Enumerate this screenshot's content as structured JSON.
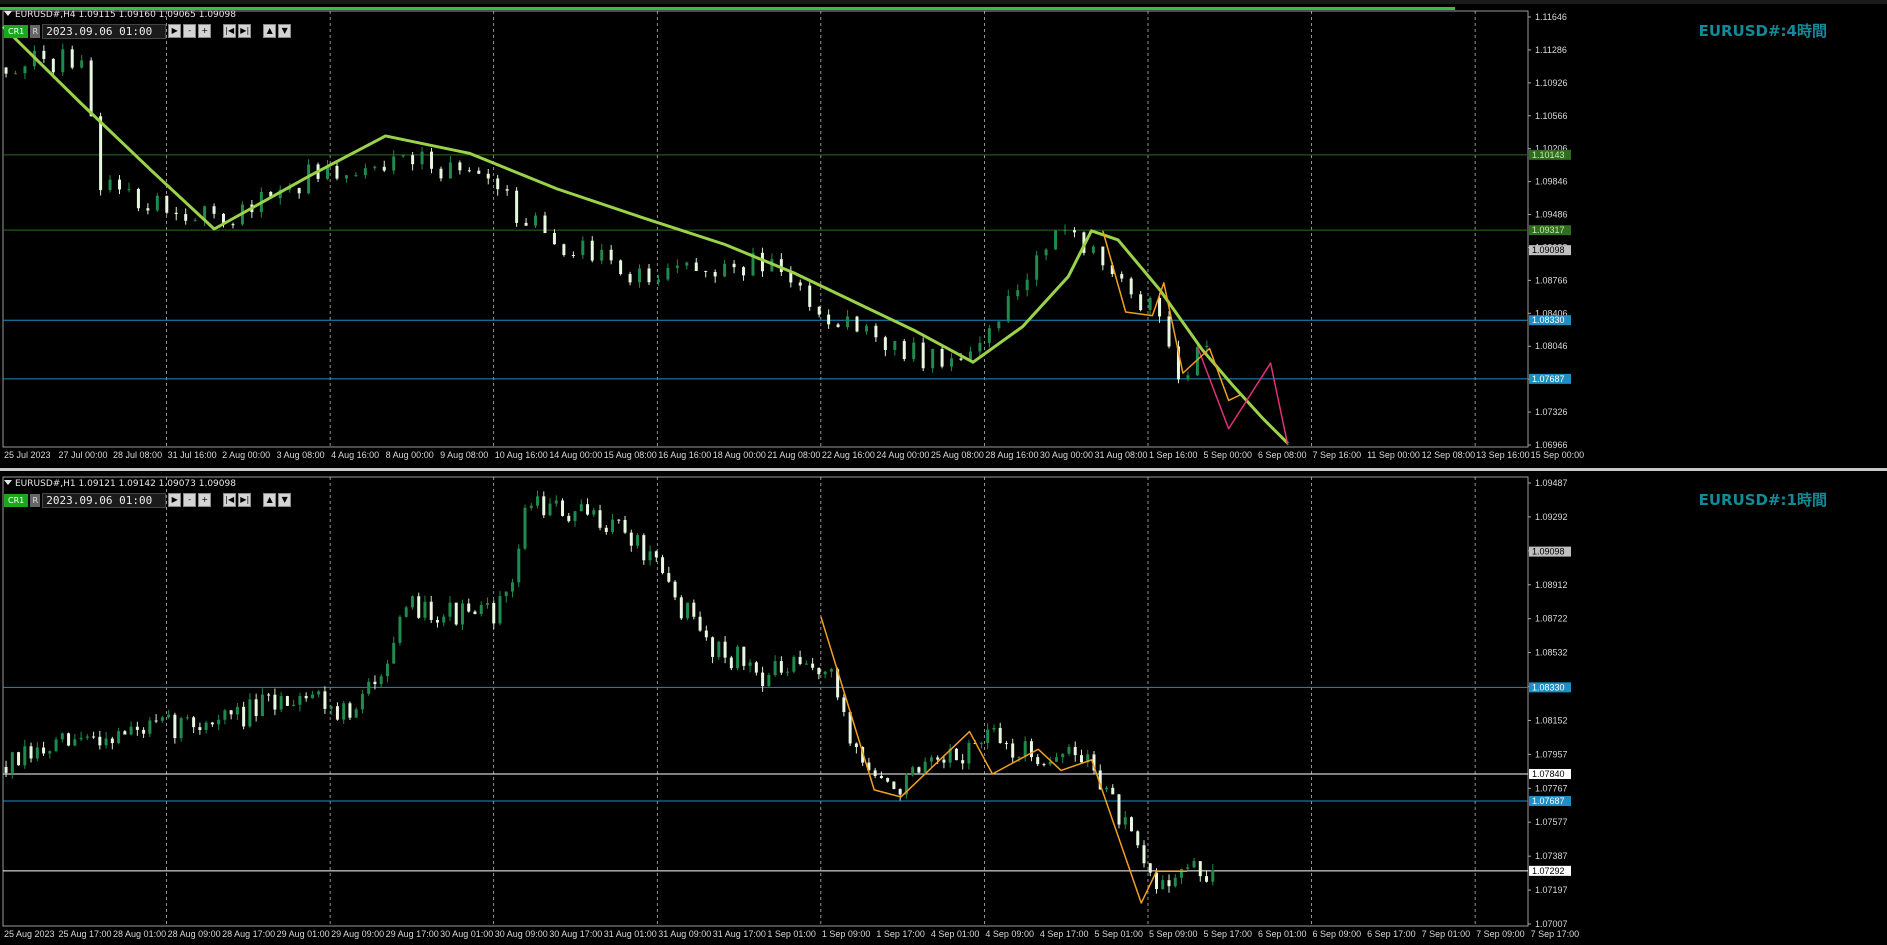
{
  "chart_data": [
    {
      "type": "candlestick",
      "header": "EURUSD#,H4  1.09115 1.09160 1.09065 1.09098",
      "title": "EURUSD#:4時間",
      "toolbar": {
        "cr": "CR1",
        "r": "R",
        "date": "2023.09.06 01:00",
        "buttons": [
          "▶",
          "-",
          "+",
          "|◀",
          "▶|",
          "▲",
          "▼"
        ]
      },
      "ylim": [
        1.0694,
        1.1172
      ],
      "price_ticks": [
        "1.11646",
        "1.11286",
        "1.10926",
        "1.10566",
        "1.10206",
        "1.09846",
        "1.09486",
        "1.09098",
        "1.08766",
        "1.08406",
        "1.08046",
        "1.07687",
        "1.07326",
        "1.06966"
      ],
      "price_labels": [
        {
          "value": 1.10143,
          "text": "1.10143",
          "bg": "#2f6e1e",
          "fg": "#c8e6b0"
        },
        {
          "value": 1.09317,
          "text": "1.09317",
          "bg": "#2f6e1e",
          "fg": "#c8e6b0"
        },
        {
          "value": 1.09098,
          "text": "1.09098",
          "bg": "#c0c0c0",
          "fg": "#000000"
        },
        {
          "value": 1.0833,
          "text": "1.08330",
          "bg": "#1e8fc0",
          "fg": "#ffffff"
        },
        {
          "value": 1.07687,
          "text": "1.07687",
          "bg": "#1e8fc0",
          "fg": "#ffffff"
        }
      ],
      "time_ticks": [
        "25 Jul 2023",
        "27 Jul 00:00",
        "28 Jul 08:00",
        "31 Jul 16:00",
        "2 Aug 00:00",
        "3 Aug 08:00",
        "4 Aug 16:00",
        "8 Aug 00:00",
        "9 Aug 08:00",
        "10 Aug 16:00",
        "14 Aug 00:00",
        "15 Aug 08:00",
        "16 Aug 16:00",
        "18 Aug 00:00",
        "21 Aug 08:00",
        "22 Aug 16:00",
        "24 Aug 00:00",
        "25 Aug 08:00",
        "28 Aug 16:00",
        "30 Aug 00:00",
        "31 Aug 08:00",
        "1 Sep 16:00",
        "5 Sep 00:00",
        "6 Sep 08:00",
        "7 Sep 16:00",
        "11 Sep 00:00",
        "12 Sep 08:00",
        "13 Sep 16:00",
        "15 Sep 00:00"
      ],
      "hlines": [
        {
          "value": 1.10143,
          "color": "#2d6e1d"
        },
        {
          "value": 1.09317,
          "color": "#2d6e1d"
        },
        {
          "value": 1.0833,
          "color": "#1e8fc0"
        },
        {
          "value": 1.07687,
          "color": "#1e8fc0"
        }
      ],
      "ma_line": {
        "color": "#9ad24a",
        "points": [
          [
            0.0,
            1.1155
          ],
          [
            0.051,
            1.1071
          ],
          [
            0.098,
            1.0996
          ],
          [
            0.1385,
            1.0933
          ],
          [
            0.2008,
            1.0991
          ],
          [
            0.2508,
            1.1035
          ],
          [
            0.3058,
            1.1016
          ],
          [
            0.3633,
            1.0977
          ],
          [
            0.4184,
            1.0946
          ],
          [
            0.4734,
            1.0916
          ],
          [
            0.5184,
            1.0885
          ],
          [
            0.5585,
            1.0853
          ],
          [
            0.5985,
            1.0821
          ],
          [
            0.6361,
            1.0787
          ],
          [
            0.6686,
            1.0826
          ],
          [
            0.6986,
            1.0881
          ],
          [
            0.7137,
            1.0931
          ],
          [
            0.7312,
            1.0921
          ],
          [
            0.7587,
            1.0866
          ],
          [
            0.7862,
            1.0801
          ],
          [
            0.8062,
            1.0762
          ],
          [
            0.8263,
            1.0725
          ],
          [
            0.8425,
            1.0698
          ]
        ]
      },
      "zigzag_orange": {
        "color": "#f0a020",
        "points": [
          [
            0.7212,
            1.0931
          ],
          [
            0.7362,
            1.0842
          ],
          [
            0.7537,
            1.0838
          ],
          [
            0.7612,
            1.0874
          ],
          [
            0.7737,
            1.0775
          ],
          [
            0.7912,
            1.0802
          ],
          [
            0.8037,
            1.0745
          ],
          [
            0.8112,
            1.0751
          ]
        ]
      },
      "zigzag_magenta": {
        "color": "#e0307a",
        "points": [
          [
            0.7837,
            1.0802
          ],
          [
            0.8037,
            1.0714
          ],
          [
            0.8312,
            1.0786
          ],
          [
            0.8425,
            1.0696
          ]
        ]
      }
    },
    {
      "type": "candlestick",
      "header": "EURUSD#,H1  1.09121 1.09142 1.09073 1.09098",
      "title": "EURUSD#:1時間",
      "toolbar": {
        "cr": "CR1",
        "r": "R",
        "date": "2023.09.06 01:00",
        "buttons": [
          "▶",
          "-",
          "+",
          "|◀",
          "▶|",
          "▲",
          "▼"
        ]
      },
      "ylim": [
        1.0698,
        1.0952
      ],
      "price_ticks": [
        "1.09487",
        "1.09292",
        "1.09098",
        "1.08912",
        "1.08722",
        "1.08532",
        "1.08342",
        "1.08152",
        "1.07957",
        "1.07767",
        "1.07577",
        "1.07387",
        "1.07197",
        "1.07007"
      ],
      "price_labels": [
        {
          "value": 1.09098,
          "text": "1.09098",
          "bg": "#c0c0c0",
          "fg": "#000000"
        },
        {
          "value": 1.0833,
          "text": "1.08330",
          "bg": "#1e8fc0",
          "fg": "#ffffff"
        },
        {
          "value": 1.0784,
          "text": "1.07840",
          "bg": "#ffffff",
          "fg": "#000000"
        },
        {
          "value": 1.07687,
          "text": "1.07687",
          "bg": "#1e8fc0",
          "fg": "#ffffff"
        },
        {
          "value": 1.07292,
          "text": "1.07292",
          "bg": "#ffffff",
          "fg": "#000000"
        }
      ],
      "time_ticks": [
        "25 Aug 2023",
        "25 Aug 17:00",
        "28 Aug 01:00",
        "28 Aug 09:00",
        "28 Aug 17:00",
        "29 Aug 01:00",
        "29 Aug 09:00",
        "29 Aug 17:00",
        "30 Aug 01:00",
        "30 Aug 09:00",
        "30 Aug 17:00",
        "31 Aug 01:00",
        "31 Aug 09:00",
        "31 Aug 17:00",
        "1 Sep 01:00",
        "1 Sep 09:00",
        "1 Sep 17:00",
        "4 Sep 01:00",
        "4 Sep 09:00",
        "4 Sep 17:00",
        "5 Sep 01:00",
        "5 Sep 09:00",
        "5 Sep 17:00",
        "6 Sep 01:00",
        "6 Sep 09:00",
        "6 Sep 17:00",
        "7 Sep 01:00",
        "7 Sep 09:00",
        "7 Sep 17:00"
      ],
      "hlines": [
        {
          "value": 1.0833,
          "color": "#1e8fc0"
        },
        {
          "value": 1.0784,
          "color": "#ffffff"
        },
        {
          "value": 1.07687,
          "color": "#1e8fc0"
        },
        {
          "value": 1.07292,
          "color": "#ffffff"
        }
      ],
      "zigzag_orange": {
        "color": "#f0a020",
        "points": [
          [
            0.5363,
            1.0873
          ],
          [
            0.5713,
            1.0775
          ],
          [
            0.5888,
            1.0771
          ],
          [
            0.6338,
            1.0808
          ],
          [
            0.6488,
            1.0784
          ],
          [
            0.6788,
            1.0798
          ],
          [
            0.6938,
            1.0786
          ],
          [
            0.7139,
            1.0792
          ],
          [
            0.7464,
            1.0711
          ],
          [
            0.7564,
            1.0729
          ],
          [
            0.7764,
            1.0729
          ]
        ]
      }
    }
  ]
}
